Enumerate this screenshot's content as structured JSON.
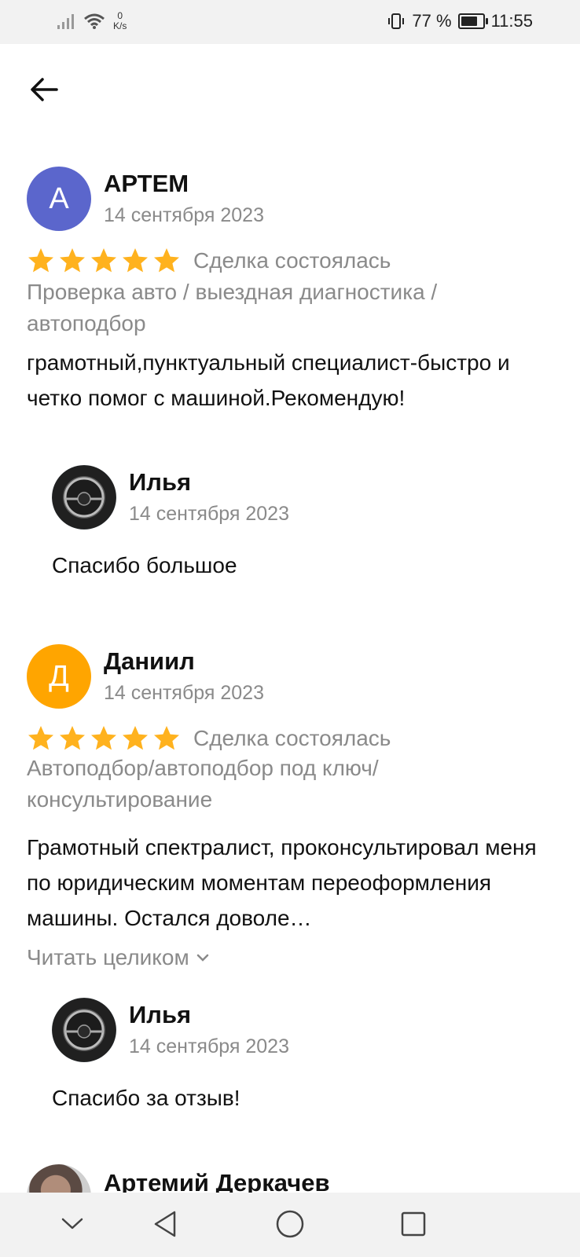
{
  "status_bar": {
    "net_speed_value": "0",
    "net_speed_unit": "K/s",
    "battery_percent": "77 %",
    "battery_level": 0.77,
    "time": "11:55"
  },
  "reviews": [
    {
      "avatar_letter": "А",
      "avatar_color": "#5b66cc",
      "name": "АРТЕМ",
      "date": "14 сентября 2023",
      "stars": 5,
      "deal_status": "Сделка состоялась",
      "service": "Проверка авто / выездная диагностика / автоподбор",
      "text": "грамотный,пунктуальный специалист-быстро и четко помог с машиной.Рекомендую!",
      "reply": {
        "name": "Илья",
        "date": "14 сентября 2023",
        "text": "Спасибо большое"
      }
    },
    {
      "avatar_letter": "Д",
      "avatar_color": "#ffa500",
      "name": "Даниил",
      "date": "14 сентября 2023",
      "stars": 5,
      "deal_status": "Сделка состоялась",
      "service": "Автоподбор/автоподбор под ключ/ консультирование",
      "text": "Грамотный спектралист, проконсультировал меня по юридическим моментам переоформления машины. Остался доволе…",
      "read_more": "Читать целиком",
      "reply": {
        "name": "Илья",
        "date": "14 сентября 2023",
        "text": "Спасибо за отзыв!"
      }
    }
  ],
  "next_review": {
    "name": "Артемий Деркачев"
  },
  "colors": {
    "star": "#ffb21e",
    "secondary_text": "#8a8a8a"
  }
}
